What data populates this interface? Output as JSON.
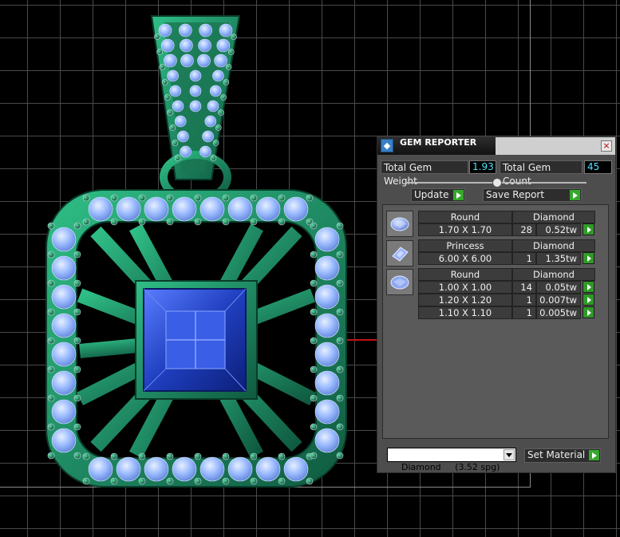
{
  "panel": {
    "title": "GEM REPORTER",
    "close_glyph": "×",
    "total_weight_label": "Total Gem Weight",
    "total_weight_value": "1.93",
    "total_count_label": "Total Gem Count",
    "total_count_value": "45",
    "update_label": "Update",
    "save_report_label": "Save Report",
    "groups": [
      {
        "icon": "round-gem-icon",
        "shape": "Round",
        "material": "Diamond",
        "rows": [
          {
            "size": "1.70 X 1.70",
            "count": "28",
            "weight": "0.52tw"
          }
        ]
      },
      {
        "icon": "princess-gem-icon",
        "shape": "Princess",
        "material": "Diamond",
        "rows": [
          {
            "size": "6.00 X 6.00",
            "count": "1",
            "weight": "1.35tw"
          }
        ]
      },
      {
        "icon": "round-gem-icon",
        "shape": "Round",
        "material": "Diamond",
        "rows": [
          {
            "size": "1.00 X 1.00",
            "count": "14",
            "weight": "0.05tw"
          },
          {
            "size": "1.20 X 1.20",
            "count": "1",
            "weight": "0.007tw"
          },
          {
            "size": "1.10 X 1.10",
            "count": "1",
            "weight": "0.005tw"
          }
        ]
      }
    ],
    "material_select_value": "Diamond     (3.52 spg)",
    "set_material_label": "Set Material"
  },
  "colors": {
    "metal": "#1f8a63",
    "gem_light": "#8fb7ff",
    "center_stone": "#1f3fbf",
    "panel_bg": "#4d4d4d",
    "accent_green": "#35a82c",
    "value_text": "#4fe3ff"
  }
}
